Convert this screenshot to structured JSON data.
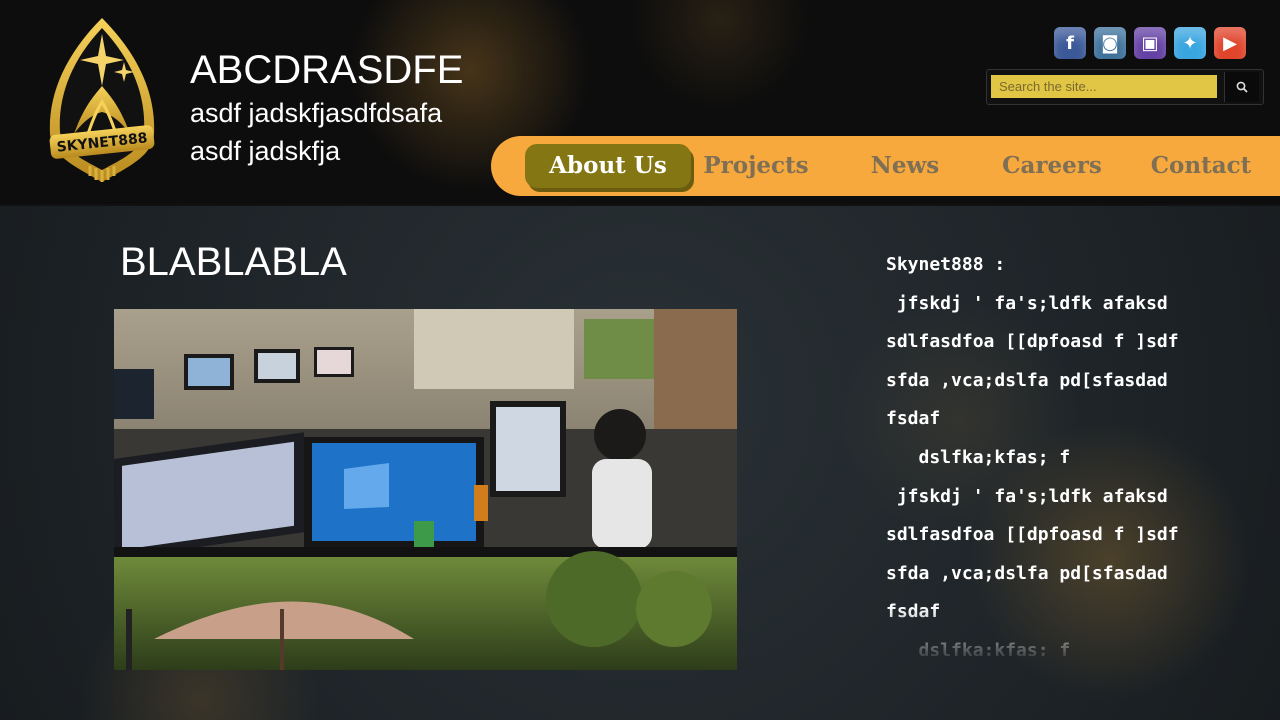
{
  "header": {
    "logo_text": "SKYNET888",
    "title": "ABCDRASDFE",
    "tagline_1": "asdf jadskfjasdfdsafa",
    "tagline_2": "asdf jadskfja"
  },
  "social": [
    {
      "name": "facebook",
      "glyph": "f",
      "color": "#3b5998"
    },
    {
      "name": "instagram",
      "glyph": "◙",
      "color": "#3f729b"
    },
    {
      "name": "twitch",
      "glyph": "▣",
      "color": "#6441a4"
    },
    {
      "name": "twitter",
      "glyph": "✦",
      "color": "#3aa6e0"
    },
    {
      "name": "youtube",
      "glyph": "▶",
      "color": "#e0452c"
    }
  ],
  "search": {
    "placeholder": "Search the site..."
  },
  "nav": [
    {
      "label": "About Us",
      "active": true
    },
    {
      "label": "Projects",
      "active": false
    },
    {
      "label": "News",
      "active": false
    },
    {
      "label": "Careers",
      "active": false
    },
    {
      "label": "Contact",
      "active": false
    }
  ],
  "main": {
    "title": "BLABLABLA"
  },
  "sidebar_text": [
    "Skynet888 :",
    " jfskdj ' fa's;ldfk afaksd",
    "sdlfasdfoa [[dpfoasd f ]sdf",
    "sfda ,vca;dslfa pd[sfasdad",
    "fsdaf",
    "   dslfka;kfas; f",
    " jfskdj ' fa's;ldfk afaksd",
    "sdlfasdfoa [[dpfoasd f ]sdf",
    "sfda ,vca;dslfa pd[sfasdad",
    "fsdaf",
    "   dslfka;kfas; f"
  ]
}
